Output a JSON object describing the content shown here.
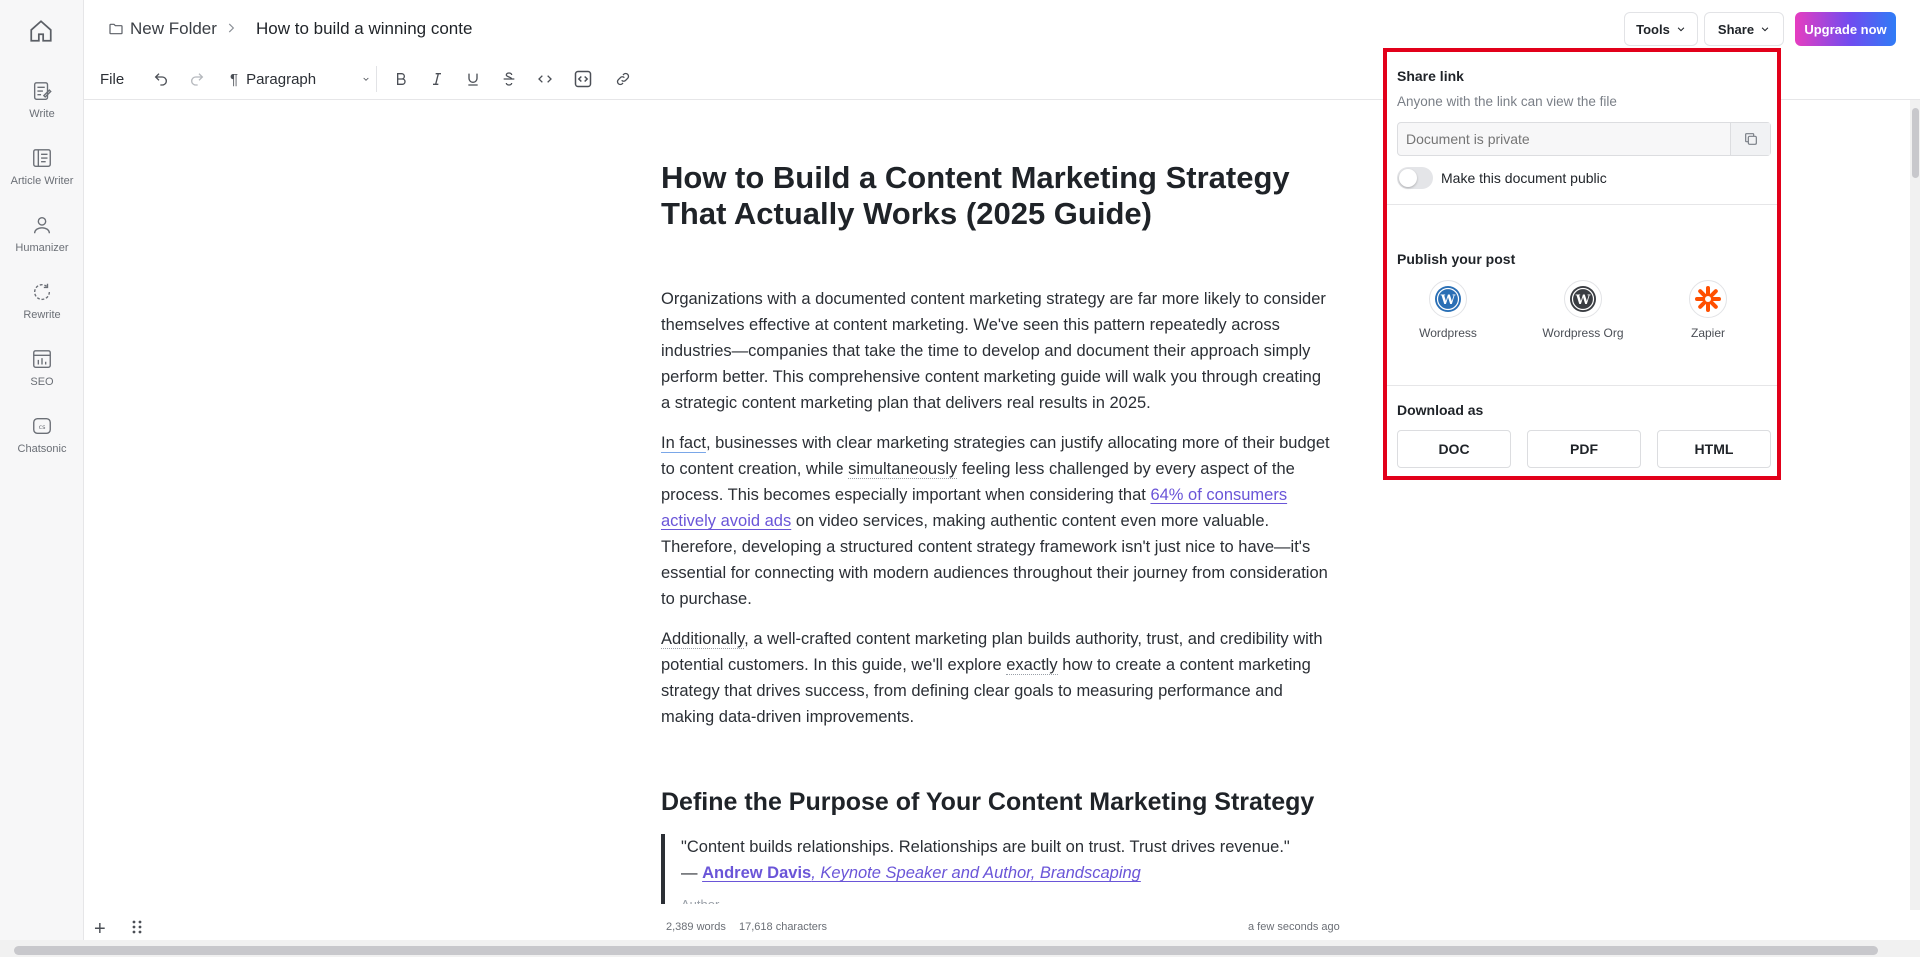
{
  "sidebar": {
    "home_icon": "home-icon",
    "items": [
      {
        "label": "Write",
        "icon": "write-icon"
      },
      {
        "label": "Article Writer",
        "icon": "article-writer-icon"
      },
      {
        "label": "Humanizer",
        "icon": "person-icon"
      },
      {
        "label": "Rewrite",
        "icon": "rewrite-icon"
      },
      {
        "label": "SEO",
        "icon": "chart-icon"
      },
      {
        "label": "Chatsonic",
        "icon": "chatsonic-icon"
      }
    ]
  },
  "header": {
    "folder": "New Folder",
    "document_title": "How to build a winning conte",
    "tools_label": "Tools",
    "share_label": "Share",
    "upgrade_label": "Upgrade now"
  },
  "toolbar": {
    "file_label": "File",
    "paragraph_style": "Paragraph"
  },
  "document": {
    "title": "How to Build a Content Marketing Strategy That Actually Works (2025 Guide)",
    "p1": "Organizations with a documented content marketing strategy are far more likely to consider themselves effective at content marketing. We've seen this pattern repeatedly across industries—companies that take the time to develop and document their approach simply perform better. This comprehensive content marketing guide will walk you through creating a strategic content marketing plan that delivers real results in 2025.",
    "p2_a": "In fact",
    "p2_b": ", businesses with clear marketing strategies can justify allocating more of their budget to content creation, while ",
    "p2_c": "simultaneously",
    "p2_d": " feeling less challenged by every aspect of the process. This becomes especially important when considering that ",
    "p2_link": "64% of consumers actively avoid ads",
    "p2_e": " on video services, making authentic content even more valuable. Therefore, developing a structured content strategy framework isn't just nice to have—it's essential for connecting with modern audiences throughout their journey from consideration to purchase.",
    "p3_a": "Additionally",
    "p3_b": ", a well-crafted content marketing plan builds authority, trust, and credibility with potential customers. In this guide, we'll explore ",
    "p3_c": "exactly",
    "p3_d": " how to create a content marketing strategy that drives success, from defining clear goals to measuring performance and making data-driven improvements.",
    "h2": "Define the Purpose of Your Content Marketing Strategy",
    "quote_text": "\"Content builds relationships. Relationships are built on trust. Trust drives revenue.\"",
    "quote_dash": "— ",
    "quote_author": "Andrew Davis",
    "quote_role": ", Keynote Speaker and Author, Brandscaping",
    "quote_caption": "Author"
  },
  "status": {
    "words": "2,389 words",
    "characters": "17,618 characters",
    "saved": "a few seconds ago"
  },
  "share_panel": {
    "title": "Share link",
    "subtitle": "Anyone with the link can view the file",
    "link_placeholder": "Document is private",
    "toggle_label": "Make this document public",
    "toggle_on": false,
    "publish_title": "Publish your post",
    "publish_targets": [
      {
        "label": "Wordpress",
        "icon": "wordpress-icon"
      },
      {
        "label": "Wordpress Org",
        "icon": "wordpress-org-icon"
      },
      {
        "label": "Zapier",
        "icon": "zapier-icon"
      }
    ],
    "download_title": "Download as",
    "download_options": [
      "DOC",
      "PDF",
      "HTML"
    ],
    "highlight_color": "#e2001a"
  },
  "colors": {
    "link": "#6a55d8",
    "upgrade_gradient": [
      "#e63dc0",
      "#6f4cf0",
      "#2f7cf6"
    ]
  }
}
